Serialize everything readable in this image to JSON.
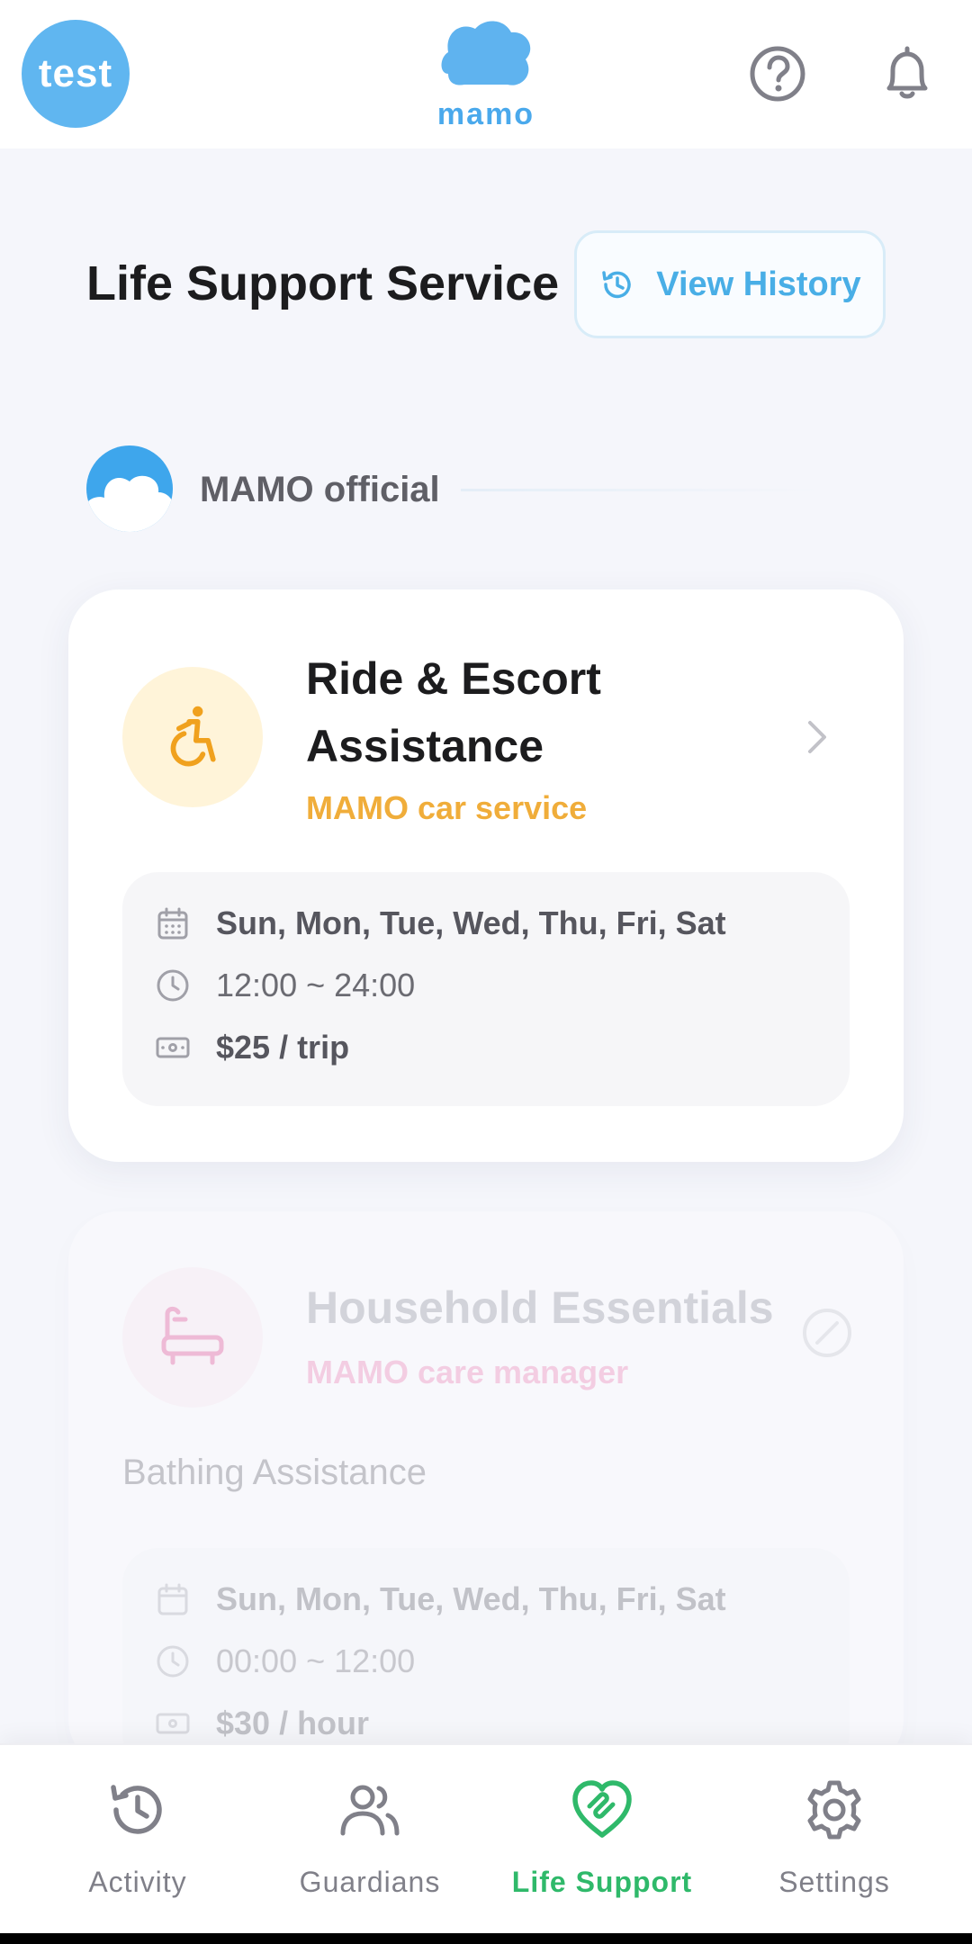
{
  "header": {
    "avatar_text": "test",
    "logo_text": "mamo",
    "help_icon": "help-circle-icon",
    "notification_icon": "bell-icon"
  },
  "page": {
    "title": "Life Support Service",
    "history_button": "View History"
  },
  "provider": {
    "name": "MAMO official"
  },
  "services": [
    {
      "title": "Ride & Escort Assistance",
      "subtitle": "MAMO car service",
      "icon": "wheelchair-icon",
      "accent": "#f0ad3a",
      "days": "Sun, Mon, Tue, Wed, Thu, Fri, Sat",
      "hours": "12:00 ~ 24:00",
      "price": "$25 / trip",
      "enabled": true
    },
    {
      "title": "Household Essentials",
      "subtitle": "MAMO care manager",
      "icon": "bathtub-icon",
      "accent": "#f07aae",
      "description": "Bathing Assistance",
      "days": "Sun, Mon, Tue, Wed, Thu, Fri, Sat",
      "hours": "00:00 ~ 12:00",
      "price": "$30 / hour",
      "enabled": false
    }
  ],
  "nav": {
    "items": [
      {
        "label": "Activity",
        "icon": "history-icon"
      },
      {
        "label": "Guardians",
        "icon": "users-icon"
      },
      {
        "label": "Life Support",
        "icon": "heart-handshake-icon",
        "active": true
      },
      {
        "label": "Settings",
        "icon": "gear-icon"
      }
    ]
  },
  "colors": {
    "brand_blue": "#4aa9ec",
    "active_green": "#2fb96a",
    "ride_accent": "#f0ad3a",
    "household_accent": "#f07aae"
  }
}
